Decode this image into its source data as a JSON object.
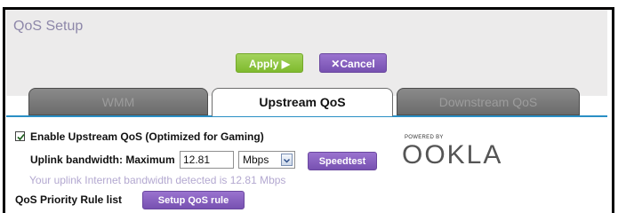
{
  "page": {
    "title": "QoS Setup"
  },
  "toolbar": {
    "apply_label": "Apply ▶",
    "cancel_label": "✕Cancel"
  },
  "tabs": [
    {
      "label": "WMM",
      "active": false
    },
    {
      "label": "Upstream QoS",
      "active": true
    },
    {
      "label": "Downstream QoS",
      "active": false
    }
  ],
  "upstream": {
    "enable_label": "Enable Upstream QoS (Optimized for Gaming)",
    "enable_checked": true,
    "bandwidth_label": "Uplink bandwidth: Maximum",
    "bandwidth_value": "12.81",
    "unit_value": "Mbps",
    "speedtest_label": "Speedtest",
    "detected_text": "Your uplink Internet bandwidth detected is 12.81 Mbps",
    "powered_by": "POWERED BY",
    "brand": "OOKLA"
  },
  "rules": {
    "label": "QoS Priority Rule list",
    "setup_label": "Setup QoS rule"
  },
  "colors": {
    "accent_green": "#7fba2e",
    "accent_purple": "#7751b1",
    "tab_line": "#2a8fc5"
  }
}
